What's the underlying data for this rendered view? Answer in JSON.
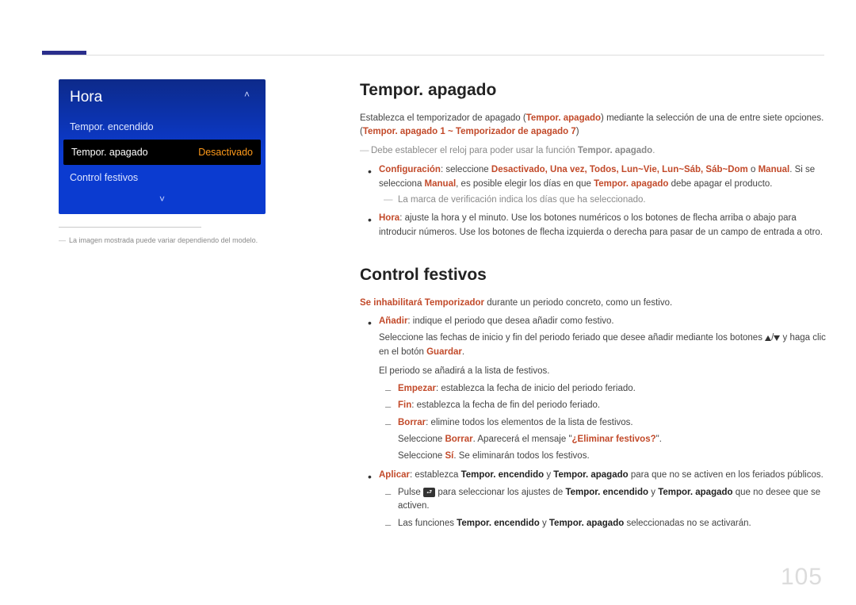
{
  "pageNumber": "105",
  "leftMenu": {
    "title": "Hora",
    "items": [
      {
        "label": "Tempor. encendido",
        "value": ""
      },
      {
        "label": "Tempor. apagado",
        "value": "Desactivado",
        "selected": true
      },
      {
        "label": "Control festivos",
        "value": ""
      }
    ],
    "captionPrefix": "―",
    "caption": "La imagen mostrada puede variar dependiendo del modelo."
  },
  "section1": {
    "heading": "Tempor. apagado",
    "intro1a": "Establezca el temporizador de apagado (",
    "intro1b": "Tempor. apagado",
    "intro1c": ") mediante la selección de una de entre siete opciones. (",
    "intro1d": "Tempor. apagado 1",
    "intro1e": " ~ ",
    "intro1f": "Temporizador de apagado 7",
    "intro1g": ")",
    "note1a": "Debe establecer el reloj para poder usar la función ",
    "note1b": "Tempor. apagado",
    "note1c": ".",
    "conf_label": "Configuración",
    "conf_a": ": seleccione ",
    "conf_opts": "Desactivado, Una vez, Todos, Lun~Vie, Lun~Sáb, Sáb~Dom",
    "conf_or": " o ",
    "conf_manual": "Manual",
    "conf_b": ". Si se selecciona ",
    "conf_c": ", es posible elegir los días en que ",
    "conf_d": "Tempor. apagado",
    "conf_e": " debe apagar el producto.",
    "subnote": "La marca de verificación indica los días que ha seleccionado.",
    "hora_label": "Hora",
    "hora_text": ": ajuste la hora y el minuto. Use los botones numéricos o los botones de flecha arriba o abajo para introducir números. Use los botones de flecha izquierda o derecha para pasar de un campo de entrada a otro."
  },
  "section2": {
    "heading": "Control festivos",
    "lead_a": "Se inhabilitará Temporizador",
    "lead_b": " durante un periodo concreto, como un festivo.",
    "add_label": "Añadir",
    "add_a": ": indique el periodo que desea añadir como festivo.",
    "add_line2a": "Seleccione las fechas de inicio y fin del periodo feriado que desee añadir mediante los botones ",
    "add_line2b": " y haga clic en el botón ",
    "add_guardar": "Guardar",
    "add_line2c": ".",
    "period_line": "El periodo se añadirá a la lista de festivos.",
    "empezar_label": "Empezar",
    "empezar_text": ": establezca la fecha de inicio del periodo feriado.",
    "fin_label": "Fin",
    "fin_text": ": establezca la fecha de fin del periodo feriado.",
    "borrar_label": "Borrar",
    "borrar_text": ": elimine todos los elementos de la lista de festivos.",
    "borrar_line2a": "Seleccione ",
    "borrar_line2b": "Borrar",
    "borrar_line2c": ". Aparecerá el mensaje \"",
    "borrar_line2d": "¿Eliminar festivos?",
    "borrar_line2e": "\".",
    "borrar_line3a": "Seleccione ",
    "borrar_line3b": "Sí",
    "borrar_line3c": ". Se eliminarán todos los festivos.",
    "aplicar_label": "Aplicar",
    "aplicar_a": ": establezca ",
    "aplicar_b": "Tempor. encendido",
    "aplicar_c": " y ",
    "aplicar_d": "Tempor. apagado",
    "aplicar_e": " para que no se activen en los feriados públicos.",
    "aplicar_s1a": "Pulse ",
    "aplicar_s1b": " para seleccionar los ajustes de ",
    "aplicar_s1c": "Tempor. encendido",
    "aplicar_s1d": " y ",
    "aplicar_s1e": "Tempor. apagado",
    "aplicar_s1f": " que no desee que se activen.",
    "aplicar_s2a": "Las funciones ",
    "aplicar_s2b": "Tempor. encendido",
    "aplicar_s2c": " y ",
    "aplicar_s2d": "Tempor. apagado",
    "aplicar_s2e": " seleccionadas no se activarán."
  }
}
